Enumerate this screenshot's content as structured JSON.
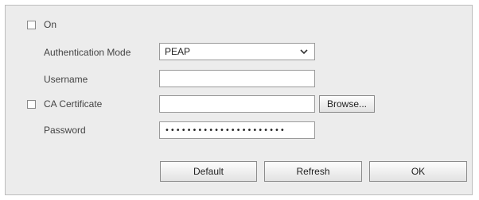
{
  "enable": {
    "label": "On",
    "checked": false
  },
  "auth_mode": {
    "label": "Authentication Mode",
    "value": "PEAP"
  },
  "username": {
    "label": "Username",
    "value": ""
  },
  "ca_cert": {
    "label": "CA Certificate",
    "checked": false,
    "value": "",
    "browse_label": "Browse..."
  },
  "password": {
    "label": "Password",
    "value": "••••••••••••••••••••••"
  },
  "buttons": {
    "default_label": "Default",
    "refresh_label": "Refresh",
    "ok_label": "OK"
  }
}
